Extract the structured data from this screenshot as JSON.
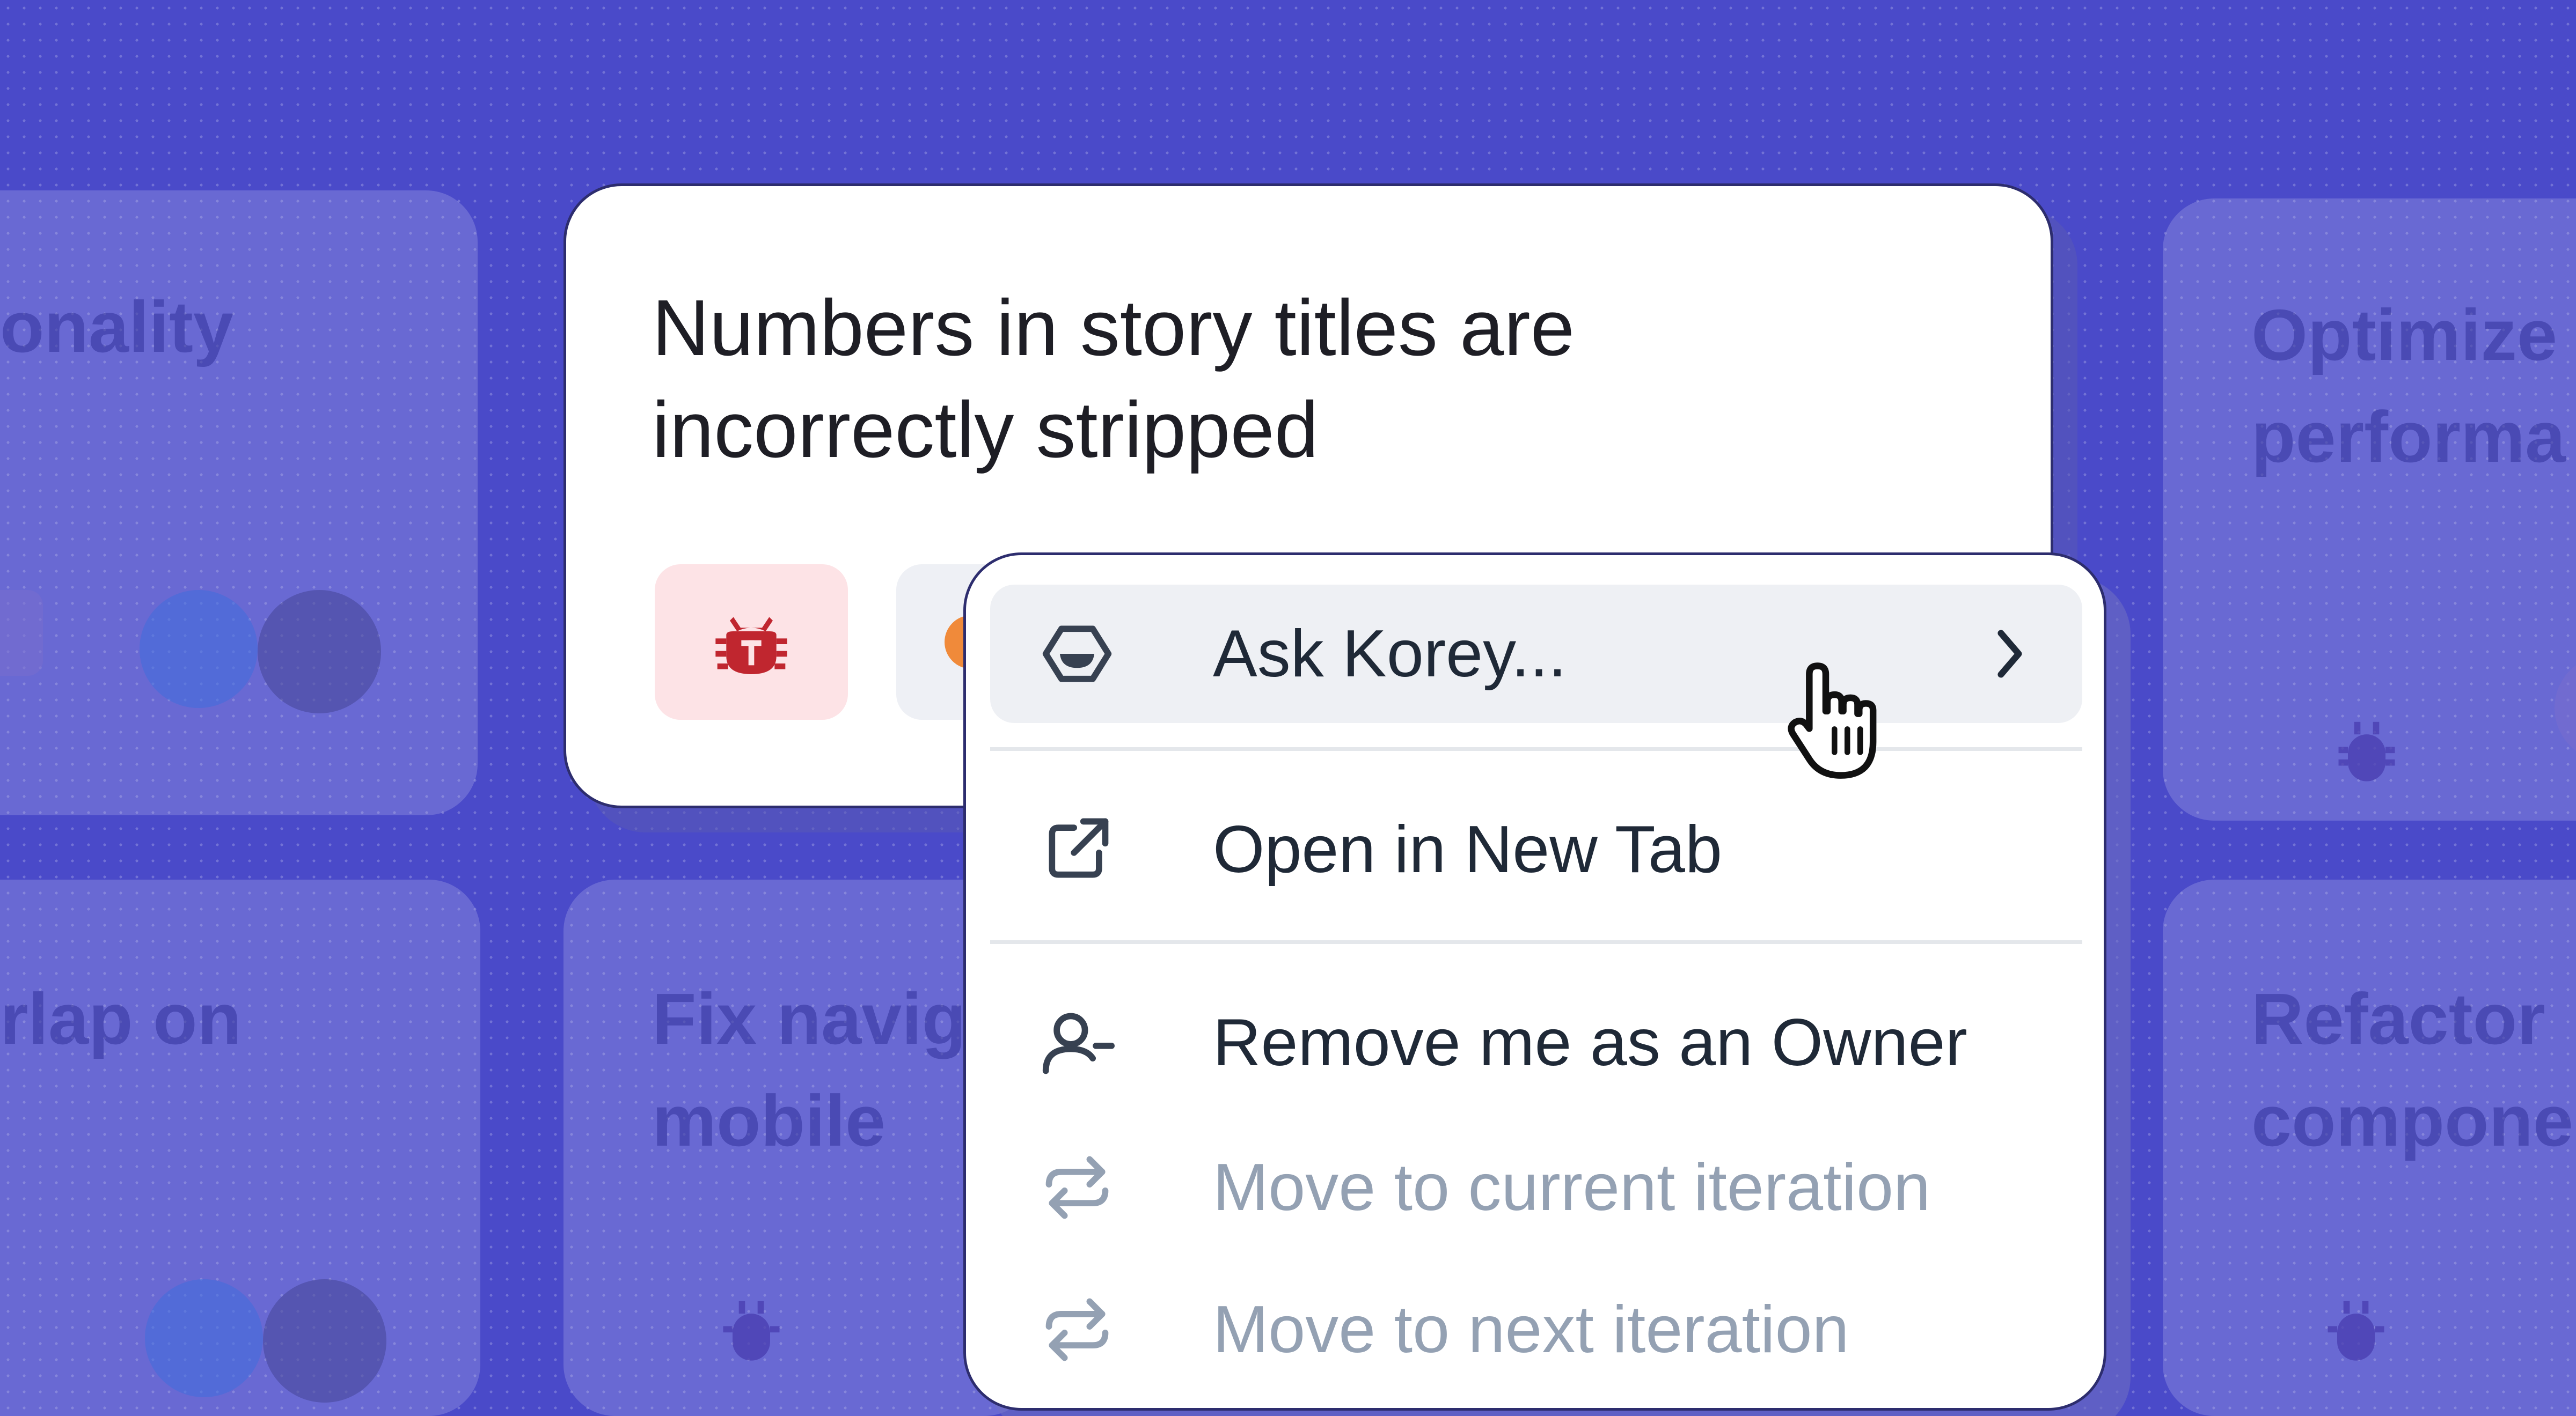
{
  "background_cards": [
    {
      "title_lines": [
        "onality"
      ]
    },
    {
      "title_lines": [
        "Optimize",
        "performa"
      ]
    },
    {
      "title_lines": [
        "rlap on"
      ]
    },
    {
      "title_lines": [
        "Fix navig",
        "mobile"
      ]
    },
    {
      "title_lines": [
        "Refactor",
        "compone"
      ]
    }
  ],
  "story": {
    "title": "Numbers in story titles are incorrectly stripped",
    "type_icon": "bug-icon"
  },
  "context_menu": {
    "items": [
      {
        "label": "Ask Korey...",
        "icon": "korey-icon",
        "has_submenu": true,
        "state": "hover"
      },
      {
        "label": "Open in New Tab",
        "icon": "external-link-icon",
        "state": "normal"
      },
      {
        "label": "Remove me as an Owner",
        "icon": "remove-user-icon",
        "state": "normal"
      },
      {
        "label": "Move to current iteration",
        "icon": "iteration-icon",
        "state": "disabled"
      },
      {
        "label": "Move to next iteration",
        "icon": "iteration-icon",
        "state": "disabled"
      }
    ]
  },
  "colors": {
    "background": "#4a4ac9",
    "bug_chip": "#fde3e6",
    "bug_icon": "#c0262f",
    "menu_hover": "#eef0f4",
    "disabled_text": "#94a1b3"
  }
}
